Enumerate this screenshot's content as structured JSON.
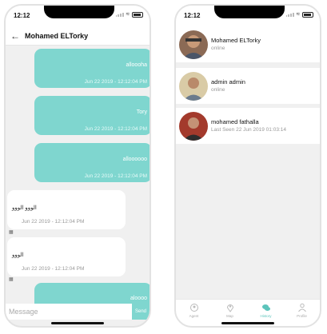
{
  "chat_screen": {
    "status_time": "12:12",
    "header": {
      "title": "Mohamed ELTorky"
    },
    "messages": [
      {
        "direction": "out",
        "text": "alloooha",
        "time": "Jun 22 2019 - 12:12:04 PM"
      },
      {
        "direction": "out",
        "text": "Tory",
        "time": "Jun 22 2019 - 12:12:04 PM"
      },
      {
        "direction": "out",
        "text": "alloooooo",
        "time": "Jun 22 2019 - 12:12:04 PM"
      },
      {
        "direction": "in",
        "text": "الووو الووو",
        "time": "Jun 22 2019 - 12:12:04 PM"
      },
      {
        "direction": "in",
        "text": "الووو",
        "time": "Jun 22 2019 - 12:12:04 PM"
      },
      {
        "direction": "out",
        "text": "aloooo",
        "time": ""
      }
    ],
    "input": {
      "placeholder": "Message",
      "value": ""
    },
    "send_label": "Send"
  },
  "contacts_screen": {
    "status_time": "12:12",
    "contacts": [
      {
        "name": "Mohamed ELTorky",
        "status": "online"
      },
      {
        "name": "admin admin",
        "status": "online"
      },
      {
        "name": "mohamed fathalla",
        "status": "Last Seen 22 Jun 2019 01:03:14"
      }
    ],
    "tabs": [
      {
        "label": "Agent",
        "icon": "agent-icon",
        "active": false
      },
      {
        "label": "Map",
        "icon": "map-pin-icon",
        "active": false
      },
      {
        "label": "History",
        "icon": "chat-bubbles-icon",
        "active": true
      },
      {
        "label": "Profile",
        "icon": "person-icon",
        "active": false
      }
    ]
  },
  "colors": {
    "accent": "#7fd6cf",
    "background": "#f0f0f0"
  }
}
